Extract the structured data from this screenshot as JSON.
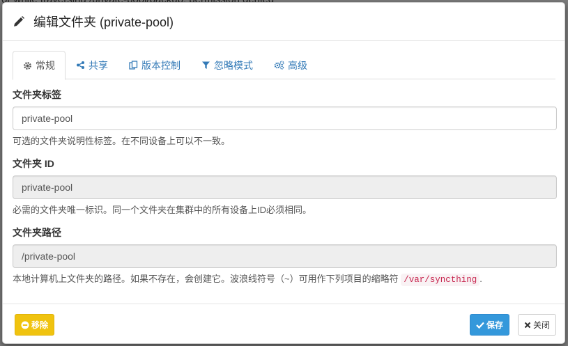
{
  "background": {
    "top_text": "or while traversing /private-pool/backup: permission denied"
  },
  "dialog": {
    "title": "编辑文件夹 (private-pool)",
    "tabs": [
      {
        "label": "常规",
        "icon": "gear-icon",
        "active": true
      },
      {
        "label": "共享",
        "icon": "share-icon",
        "active": false
      },
      {
        "label": "版本控制",
        "icon": "copy-icon",
        "active": false
      },
      {
        "label": "忽略模式",
        "icon": "filter-icon",
        "active": false
      },
      {
        "label": "高级",
        "icon": "cogs-icon",
        "active": false
      }
    ],
    "fields": {
      "label": {
        "title": "文件夹标签",
        "value": "private-pool",
        "help": "可选的文件夹说明性标签。在不同设备上可以不一致。"
      },
      "id": {
        "title": "文件夹 ID",
        "value": "private-pool",
        "help": "必需的文件夹唯一标识。同一个文件夹在集群中的所有设备上ID必须相同。"
      },
      "path": {
        "title": "文件夹路径",
        "value": "/private-pool",
        "help_prefix": "本地计算机上文件夹的路径。如果不存在，会创建它。波浪线符号（~）可用作下列项目的缩略符",
        "help_code": "/var/syncthing",
        "help_suffix": "."
      }
    },
    "footer": {
      "remove_label": "移除",
      "save_label": "保存",
      "close_label": "关闭"
    }
  },
  "colors": {
    "link": "#337ab7",
    "warning": "#f0c30f",
    "primary": "#3498db",
    "code": "#c7254e"
  }
}
